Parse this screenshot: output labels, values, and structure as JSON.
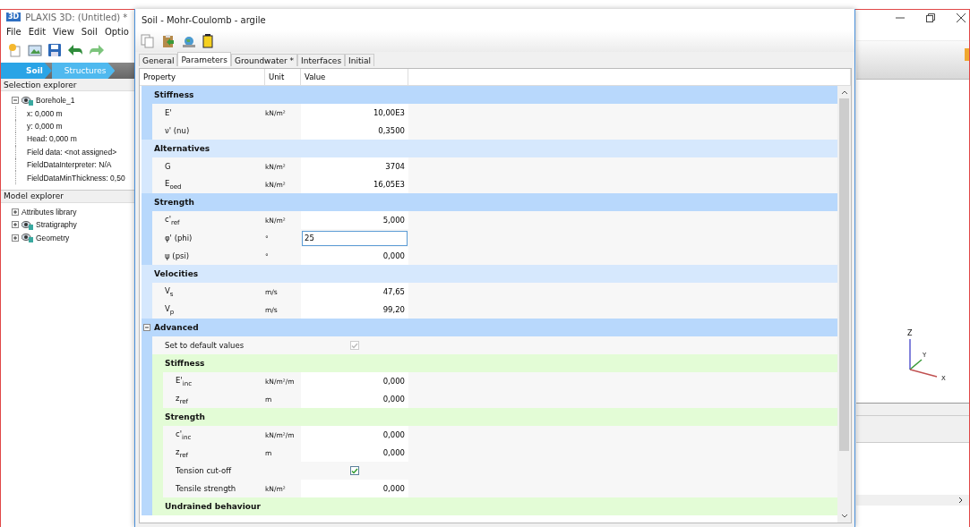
{
  "main_window": {
    "app_icon": "3D",
    "title": "PLAXIS 3D: (Untitled) *",
    "menu": [
      "File",
      "Edit",
      "View",
      "Soil",
      "Optio"
    ],
    "mode_tabs": [
      {
        "label": "Soil",
        "selected": true
      },
      {
        "label": "Structures",
        "selected": false
      }
    ],
    "selection_explorer": {
      "title": "Selection explorer",
      "items": [
        {
          "label": "Borehole_1",
          "expanded": true,
          "visible_icon": true,
          "children": [
            {
              "label": "x: 0,000 m"
            },
            {
              "label": "y: 0,000 m"
            },
            {
              "label": "Head: 0,000 m"
            },
            {
              "label": "Field data: <not assigned>"
            },
            {
              "label": "FieldDataInterpreter: N/A"
            },
            {
              "label": "FieldDataMinThickness: 0,50"
            }
          ]
        }
      ]
    },
    "model_explorer": {
      "title": "Model explorer",
      "items": [
        {
          "label": "Attributes library",
          "expanded": false,
          "visible_icon": false
        },
        {
          "label": "Stratigraphy",
          "expanded": false,
          "visible_icon": true
        },
        {
          "label": "Geometry",
          "expanded": false,
          "visible_icon": true
        }
      ]
    },
    "axes": {
      "labels": [
        "Z",
        "Y",
        "X"
      ]
    }
  },
  "dialog": {
    "title": "Soil - Mohr-Coulomb - argile",
    "tabs": [
      {
        "label": "General",
        "selected": false
      },
      {
        "label": "Parameters",
        "selected": true
      },
      {
        "label": "Groundwater *",
        "selected": false
      },
      {
        "label": "Interfaces",
        "selected": false
      },
      {
        "label": "Initial",
        "selected": false
      }
    ],
    "table": {
      "columns": [
        "Property",
        "Unit",
        "Value"
      ],
      "rows": [
        {
          "kind": "group",
          "label": "Stiffness",
          "color": "#b8d8fc",
          "children": [
            {
              "kind": "property",
              "label": "E'",
              "unit": "kN/m²",
              "value": "10,00E3"
            },
            {
              "kind": "property",
              "label": "ν' (nu)",
              "value": "0,3500"
            }
          ]
        },
        {
          "kind": "group",
          "label": "Alternatives",
          "color": "#d6e8fd",
          "children": [
            {
              "kind": "property",
              "label": "G",
              "unit": "kN/m²",
              "value": "3704"
            },
            {
              "kind": "property",
              "label": "E$_{oed}$",
              "unit": "kN/m²",
              "value": "16,05E3"
            }
          ]
        },
        {
          "kind": "group",
          "label": "Strength",
          "color": "#b8d8fc",
          "children": [
            {
              "kind": "property",
              "label": "c'$_{ref}$",
              "unit": "kN/m²",
              "value": "5,000"
            },
            {
              "kind": "property",
              "label": "φ' (phi)",
              "unit": "°",
              "value": "25",
              "editing": true
            },
            {
              "kind": "property",
              "label": "ψ (psi)",
              "unit": "°",
              "value": "0,000"
            }
          ]
        },
        {
          "kind": "group",
          "label": "Velocities",
          "color": "#d6e8fd",
          "children": [
            {
              "kind": "property",
              "label": "V$_{s}$",
              "unit": "m/s",
              "value": "47,65"
            },
            {
              "kind": "property",
              "label": "V$_{p}$",
              "unit": "m/s",
              "value": "99,20"
            }
          ]
        },
        {
          "kind": "group",
          "label": "Advanced",
          "color": "#b8d8fc",
          "expanded": true,
          "children": [
            {
              "kind": "checkbox",
              "label": "Set to default values",
              "checked": true,
              "disabled": true
            },
            {
              "kind": "group",
              "label": "Stiffness",
              "color": "#e3fcd6",
              "children": [
                {
                  "kind": "property",
                  "label": "E'$_{inc}$",
                  "unit": "kN/m²/m",
                  "value": "0,000"
                },
                {
                  "kind": "property",
                  "label": "z$_{ref}$",
                  "unit": "m",
                  "value": "0,000"
                }
              ]
            },
            {
              "kind": "group",
              "label": "Strength",
              "color": "#e3fcd6",
              "children": [
                {
                  "kind": "property",
                  "label": "c'$_{inc}$",
                  "unit": "kN/m²/m",
                  "value": "0,000"
                },
                {
                  "kind": "property",
                  "label": "z$_{ref}$",
                  "unit": "m",
                  "value": "0,000"
                },
                {
                  "kind": "checkbox",
                  "label": "Tension cut-off",
                  "checked": true,
                  "disabled": false
                },
                {
                  "kind": "property",
                  "label": "Tensile strength",
                  "unit": "kN/m²",
                  "value": "0,000"
                }
              ]
            },
            {
              "kind": "group",
              "label": "Undrained behaviour",
              "color": "#e3fcd6"
            }
          ]
        }
      ]
    }
  }
}
